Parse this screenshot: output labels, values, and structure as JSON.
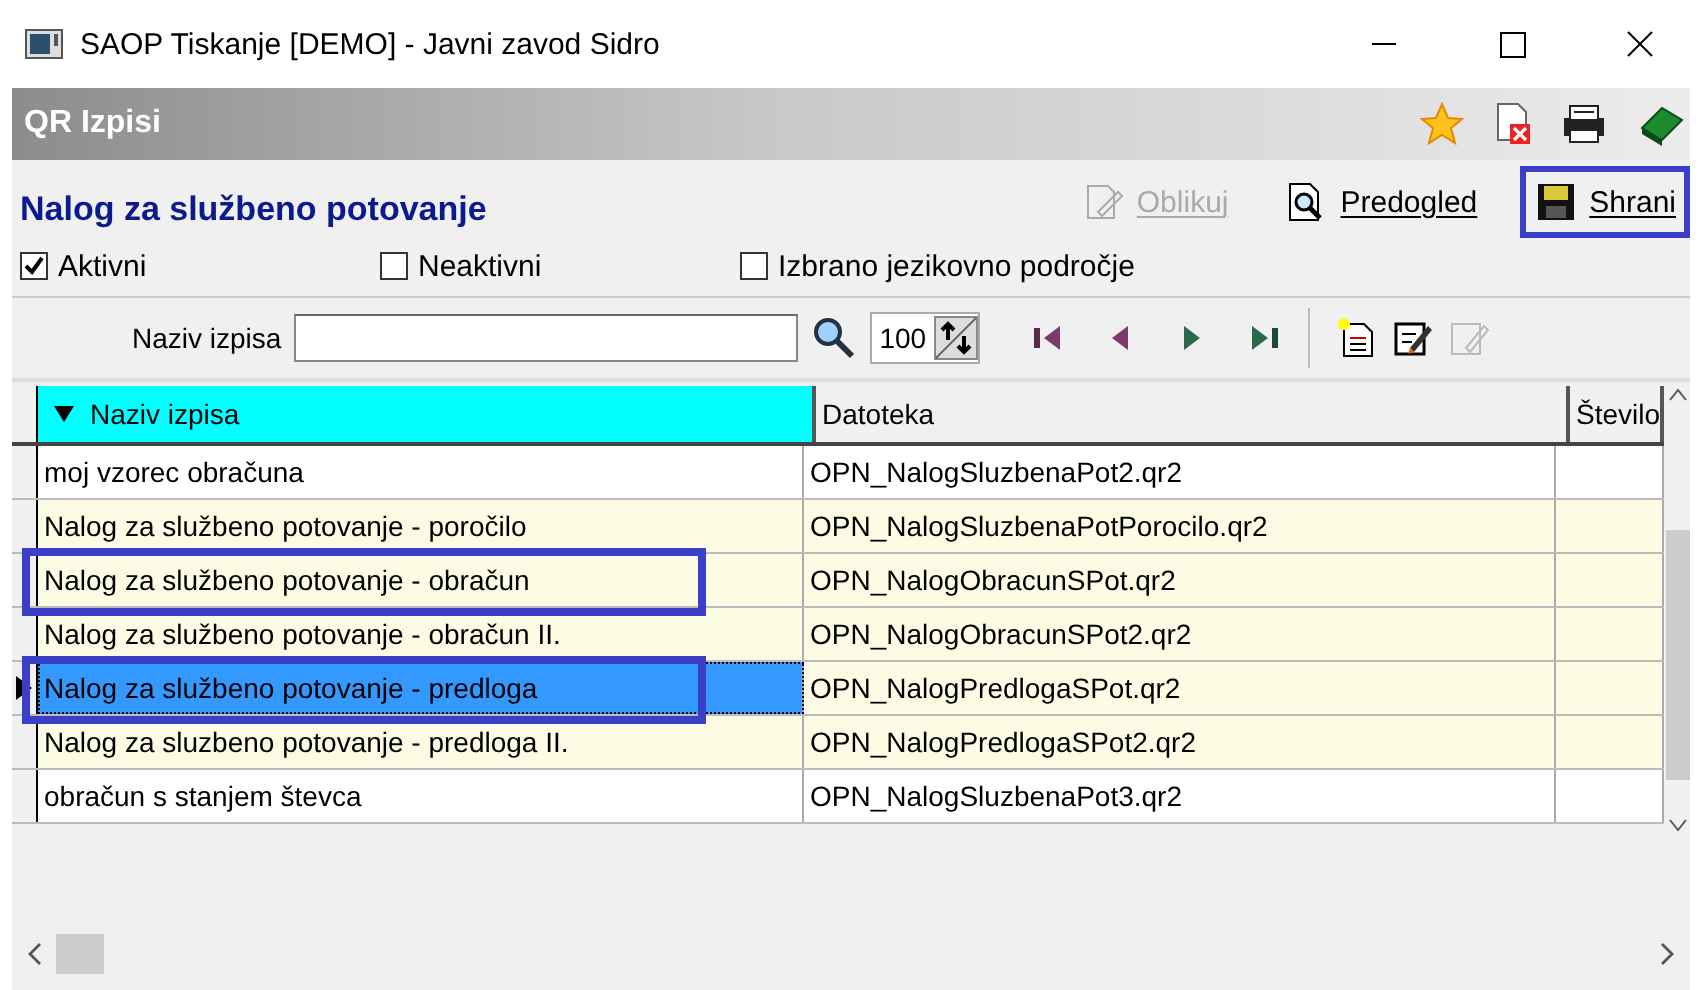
{
  "window": {
    "title": "SAOP Tiskanje [DEMO] - Javni zavod Sidro"
  },
  "header": {
    "title": "QR Izpisi"
  },
  "form": {
    "title": "Nalog za službeno potovanje",
    "actions": [
      {
        "kind": "edit",
        "label": "Oblikuj",
        "disabled": true,
        "highlighted": false
      },
      {
        "kind": "preview",
        "label": "Predogled",
        "disabled": false,
        "highlighted": false
      },
      {
        "kind": "save",
        "label": "Shrani",
        "disabled": false,
        "highlighted": true
      }
    ],
    "filters": [
      {
        "label": "Aktivni",
        "checked": true
      },
      {
        "label": "Neaktivni",
        "checked": false
      },
      {
        "label": "Izbrano jezikovno področje",
        "checked": false
      }
    ]
  },
  "search": {
    "label": "Naziv izpisa",
    "count": "100"
  },
  "table": {
    "columns": [
      {
        "label": "Naziv izpisa",
        "sorted": true
      },
      {
        "label": "Datoteka",
        "sorted": false
      },
      {
        "label": "Število",
        "sorted": false
      }
    ],
    "rows": [
      {
        "name": "moj vzorec obračuna",
        "file": "OPN_NalogSluzbenaPot2.qr2",
        "shaded": false,
        "selected": false,
        "highlighted": false
      },
      {
        "name": "Nalog za  službeno potovanje - poročilo",
        "file": "OPN_NalogSluzbenaPotPorocilo.qr2",
        "shaded": true,
        "selected": false,
        "highlighted": false
      },
      {
        "name": "Nalog za službeno potovanje - obračun",
        "file": "OPN_NalogObracunSPot.qr2",
        "shaded": true,
        "selected": false,
        "highlighted": true
      },
      {
        "name": "Nalog za službeno potovanje - obračun II.",
        "file": "OPN_NalogObracunSPot2.qr2",
        "shaded": true,
        "selected": false,
        "highlighted": false
      },
      {
        "name": "Nalog za službeno potovanje - predloga",
        "file": "OPN_NalogPredlogaSPot.qr2",
        "shaded": true,
        "selected": true,
        "highlighted": true
      },
      {
        "name": "Nalog za sluzbeno potovanje - predloga II.",
        "file": "OPN_NalogPredlogaSPot2.qr2",
        "shaded": true,
        "selected": false,
        "highlighted": false
      },
      {
        "name": "obračun s stanjem števca",
        "file": "OPN_NalogSluzbenaPot3.qr2",
        "shaded": false,
        "selected": false,
        "highlighted": false
      }
    ]
  }
}
